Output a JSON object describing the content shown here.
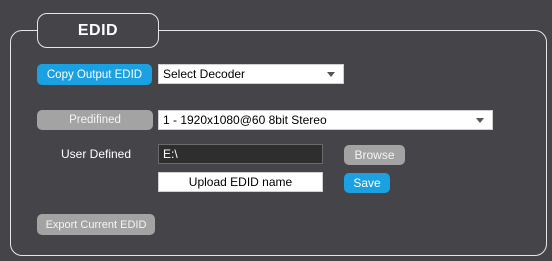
{
  "panel": {
    "tab_title": "EDID"
  },
  "copy_output": {
    "button_label": "Copy Output EDID",
    "decoder_select_value": "Select Decoder"
  },
  "predefined": {
    "button_label": "Predifined",
    "select_value": "1 - 1920x1080@60 8bit Stereo"
  },
  "user_defined": {
    "label": "User Defined",
    "path_value": "E:\\",
    "browse_label": "Browse",
    "name_field_value": "Upload EDID name",
    "save_label": "Save"
  },
  "export": {
    "button_label": "Export Current EDID"
  },
  "colors": {
    "background": "#444449",
    "accent_blue": "#1ba1e2",
    "button_gray": "#a3a3a3",
    "border": "#e6e6e6"
  }
}
